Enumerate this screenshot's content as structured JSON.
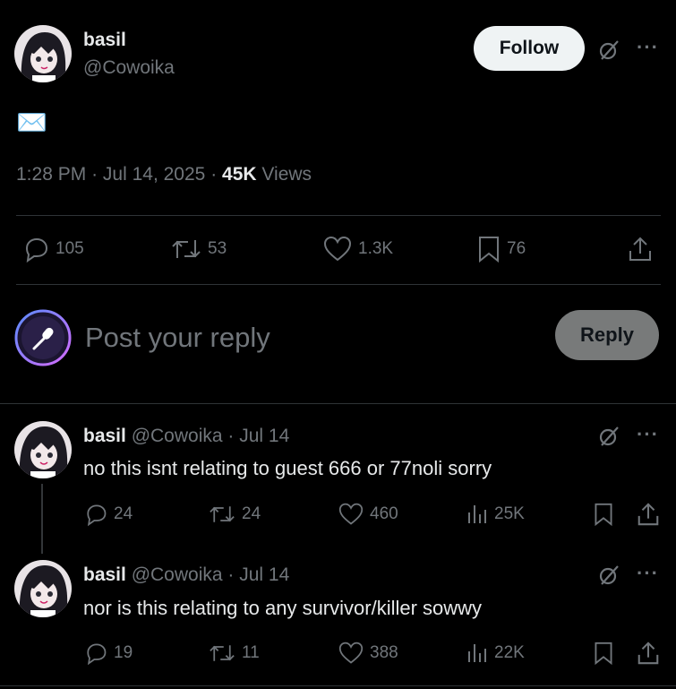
{
  "main_post": {
    "display_name": "basil",
    "handle": "@Cowoika",
    "follow_label": "Follow",
    "body_emoji": "✉️",
    "time": "1:28 PM",
    "date": "Jul 14, 2025",
    "views_count": "45K",
    "views_label": "Views",
    "replies": "105",
    "reposts": "53",
    "likes": "1.3K",
    "bookmarks": "76"
  },
  "composer": {
    "placeholder": "Post your reply",
    "reply_label": "Reply"
  },
  "replies": [
    {
      "display_name": "basil",
      "handle": "@Cowoika",
      "date": "Jul 14",
      "text": "no this isnt relating to guest 666 or 77noli sorry",
      "replies": "24",
      "reposts": "24",
      "likes": "460",
      "views": "25K"
    },
    {
      "display_name": "basil",
      "handle": "@Cowoika",
      "date": "Jul 14",
      "text": "nor is this relating to any survivor/killer sowwy",
      "replies": "19",
      "reposts": "11",
      "likes": "388",
      "views": "22K"
    }
  ],
  "colors": {
    "background": "#000000",
    "text": "#e7e9ea",
    "muted": "#71767b",
    "divider": "#2f3336",
    "follow_bg": "#eff3f4",
    "reply_bg": "#787a7a"
  },
  "icons": {
    "grok": "grok-icon",
    "more": "more-icon",
    "reply": "reply-icon",
    "repost": "repost-icon",
    "like": "heart-icon",
    "bookmark": "bookmark-icon",
    "share": "share-icon",
    "views": "views-icon",
    "mic": "microphone-icon"
  }
}
